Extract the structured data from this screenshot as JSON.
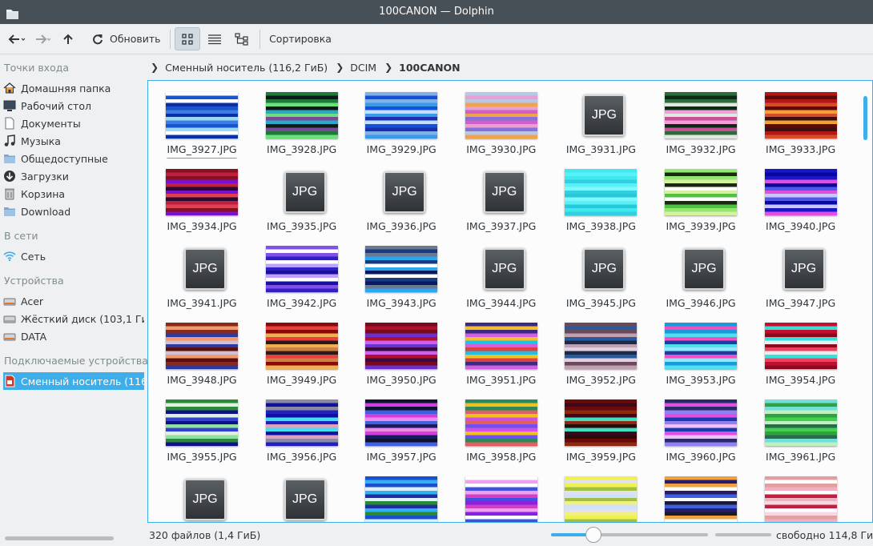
{
  "window": {
    "title": "100CANON — Dolphin"
  },
  "toolbar": {
    "reload_label": "Обновить",
    "sort_label": "Сортировка"
  },
  "sidebar": {
    "sections": [
      {
        "title": "Точки входа"
      },
      {
        "title": "В сети"
      },
      {
        "title": "Устройства"
      },
      {
        "title": "Подключаемые устройства"
      }
    ],
    "places": [
      {
        "label": "Домашняя папка",
        "icon": "home-icon"
      },
      {
        "label": "Рабочий стол",
        "icon": "desktop-icon"
      },
      {
        "label": "Документы",
        "icon": "document-icon"
      },
      {
        "label": "Музыка",
        "icon": "music-icon"
      },
      {
        "label": "Общедоступные",
        "icon": "folder-icon"
      },
      {
        "label": "Загрузки",
        "icon": "download-icon"
      },
      {
        "label": "Корзина",
        "icon": "trash-icon"
      },
      {
        "label": "Download",
        "icon": "folder-icon"
      }
    ],
    "network": [
      {
        "label": "Сеть",
        "icon": "wifi-icon"
      }
    ],
    "devices": [
      {
        "label": "Acer",
        "icon": "drive-icon"
      },
      {
        "label": "Жёсткий диск (103,1 ГиБ)",
        "icon": "drive-icon"
      },
      {
        "label": "DATA",
        "icon": "drive-icon"
      }
    ],
    "removable": [
      {
        "label": "Сменный носитель (116,2 ГиБ)",
        "icon": "sd-card-icon"
      }
    ]
  },
  "breadcrumb": [
    {
      "label": "Сменный носитель (116,2 ГиБ)"
    },
    {
      "label": "DCIM"
    },
    {
      "label": "100CANON"
    }
  ],
  "files": [
    {
      "name": "IMG_3927.JPG",
      "thumb": "glitch",
      "colors": [
        "#ffffff",
        "#1a55cc",
        "#0a2fa8",
        "#3b7ce8",
        "#9ad8f2"
      ]
    },
    {
      "name": "IMG_3928.JPG",
      "thumb": "glitch",
      "colors": [
        "#1e7a3a",
        "#0f1a16",
        "#6ce07a",
        "#2aa8c8",
        "#7a4a9a"
      ]
    },
    {
      "name": "IMG_3929.JPG",
      "thumb": "glitch",
      "colors": [
        "#7fb0e8",
        "#1750d8",
        "#3a9ae8",
        "#c0e0ff",
        "#1a2fb0"
      ]
    },
    {
      "name": "IMG_3930.JPG",
      "thumb": "glitch",
      "colors": [
        "#b8c6e8",
        "#e8a0d0",
        "#f4a24a",
        "#d060c8",
        "#8870d8"
      ]
    },
    {
      "name": "IMG_3931.JPG",
      "thumb": "jpg"
    },
    {
      "name": "IMG_3932.JPG",
      "thumb": "glitch",
      "colors": [
        "#2e6a3c",
        "#0e2a16",
        "#e0e8e0",
        "#f0a0d8",
        "#c85098"
      ]
    },
    {
      "name": "IMG_3933.JPG",
      "thumb": "glitch",
      "colors": [
        "#b01818",
        "#5c0a0a",
        "#d84a2a",
        "#f2a030",
        "#3a1010"
      ]
    },
    {
      "name": "IMG_3934.JPG",
      "thumb": "glitch",
      "colors": [
        "#8a1020",
        "#c02040",
        "#7a10d0",
        "#2a0a30",
        "#e04050"
      ]
    },
    {
      "name": "IMG_3935.JPG",
      "thumb": "jpg"
    },
    {
      "name": "IMG_3936.JPG",
      "thumb": "jpg"
    },
    {
      "name": "IMG_3937.JPG",
      "thumb": "jpg"
    },
    {
      "name": "IMG_3938.JPG",
      "thumb": "glitch",
      "colors": [
        "#40e8f0",
        "#5af0f8",
        "#30d0e0",
        "#80f8ff",
        "#28c8d8"
      ]
    },
    {
      "name": "IMG_3939.JPG",
      "thumb": "glitch",
      "colors": [
        "#90e870",
        "#1a2a10",
        "#d8f0a0",
        "#ffffff",
        "#50c040"
      ]
    },
    {
      "name": "IMG_3940.JPG",
      "thumb": "glitch",
      "colors": [
        "#1818c8",
        "#0808a0",
        "#e050e0",
        "#5058e8",
        "#c8c8f8"
      ]
    },
    {
      "name": "IMG_3941.JPG",
      "thumb": "jpg"
    },
    {
      "name": "IMG_3942.JPG",
      "thumb": "glitch",
      "colors": [
        "#8050e8",
        "#ffffff",
        "#3020c0",
        "#c0a0ff",
        "#1a10a0"
      ]
    },
    {
      "name": "IMG_3943.JPG",
      "thumb": "glitch",
      "colors": [
        "#6a7a90",
        "#1a3a80",
        "#28a8f0",
        "#ffffff",
        "#0a1a60"
      ]
    },
    {
      "name": "IMG_3944.JPG",
      "thumb": "jpg"
    },
    {
      "name": "IMG_3945.JPG",
      "thumb": "jpg"
    },
    {
      "name": "IMG_3946.JPG",
      "thumb": "jpg"
    },
    {
      "name": "IMG_3947.JPG",
      "thumb": "jpg"
    },
    {
      "name": "IMG_3948.JPG",
      "thumb": "glitch",
      "colors": [
        "#8a2a1a",
        "#f09a70",
        "#2a3aa0",
        "#d0c0d0",
        "#5a1010"
      ]
    },
    {
      "name": "IMG_3949.JPG",
      "thumb": "glitch",
      "colors": [
        "#8a0a0a",
        "#e84040",
        "#f0b050",
        "#2a1a1a",
        "#d08040"
      ]
    },
    {
      "name": "IMG_3950.JPG",
      "thumb": "glitch",
      "colors": [
        "#7a0a1a",
        "#b01030",
        "#6a30d0",
        "#d060e8",
        "#3a0a40"
      ]
    },
    {
      "name": "IMG_3951.JPG",
      "thumb": "glitch",
      "colors": [
        "#3a2a80",
        "#f0c030",
        "#d060e0",
        "#20c0e0",
        "#e04040"
      ]
    },
    {
      "name": "IMG_3952.JPG",
      "thumb": "glitch",
      "colors": [
        "#6a4a5a",
        "#2a5a9a",
        "#c0a0b0",
        "#1a2a4a",
        "#e0d0e0"
      ]
    },
    {
      "name": "IMG_3953.JPG",
      "thumb": "glitch",
      "colors": [
        "#1a9ad8",
        "#f050c0",
        "#50e0f0",
        "#203aa0",
        "#90e8f8"
      ]
    },
    {
      "name": "IMG_3954.JPG",
      "thumb": "glitch",
      "colors": [
        "#c01030",
        "#3ae0d8",
        "#8a0a20",
        "#e0f0f0",
        "#f04060"
      ]
    },
    {
      "name": "IMG_3955.JPG",
      "thumb": "glitch",
      "colors": [
        "#2a8a3a",
        "#e0f0e0",
        "#10108a",
        "#3040d0",
        "#90e0a0"
      ]
    },
    {
      "name": "IMG_3956.JPG",
      "thumb": "glitch",
      "colors": [
        "#8a8aa0",
        "#1010a0",
        "#2020c0",
        "#40e0f0",
        "#e0a0c0"
      ]
    },
    {
      "name": "IMG_3957.JPG",
      "thumb": "glitch",
      "colors": [
        "#101030",
        "#d040e0",
        "#4060e0",
        "#f08ae8",
        "#1a1a60"
      ]
    },
    {
      "name": "IMG_3958.JPG",
      "thumb": "glitch",
      "colors": [
        "#2a8a5a",
        "#f0c020",
        "#e06060",
        "#d050e0",
        "#7050f0"
      ]
    },
    {
      "name": "IMG_3959.JPG",
      "thumb": "glitch",
      "colors": [
        "#6a0a0a",
        "#3a0a1a",
        "#8a2a10",
        "#40e0c0",
        "#2a0a0a"
      ]
    },
    {
      "name": "IMG_3960.JPG",
      "thumb": "glitch",
      "colors": [
        "#2a2a6a",
        "#e050e0",
        "#9080f0",
        "#1a3ab0",
        "#f0c0f8"
      ]
    },
    {
      "name": "IMG_3961.JPG",
      "thumb": "glitch",
      "colors": [
        "#70e0d8",
        "#30a040",
        "#c0f0c0",
        "#40d050",
        "#2a6a4a"
      ]
    },
    {
      "name": "",
      "thumb": "jpg"
    },
    {
      "name": "",
      "thumb": "jpg"
    },
    {
      "name": "",
      "thumb": "glitch",
      "colors": [
        "#1a50d0",
        "#30b0f0",
        "#e0f0ff",
        "#1a30a0",
        "#2a8a30"
      ]
    },
    {
      "name": "",
      "thumb": "glitch",
      "colors": [
        "#ffffff",
        "#f0a0f0",
        "#4050e0",
        "#d040c0",
        "#8a20e0"
      ]
    },
    {
      "name": "",
      "thumb": "glitch",
      "colors": [
        "#f0f050",
        "#e0e0f0",
        "#a0c040",
        "#d0e0ff",
        "#f0f080"
      ]
    },
    {
      "name": "",
      "thumb": "glitch",
      "colors": [
        "#f0a040",
        "#2a1a6a",
        "#ffffff",
        "#4060e0",
        "#1a1a30"
      ]
    },
    {
      "name": "",
      "thumb": "glitch",
      "colors": [
        "#e0a0a0",
        "#ffffff",
        "#f0b0c0",
        "#c02040",
        "#f8d8e0"
      ]
    }
  ],
  "jpg_label": "JPG",
  "status": {
    "count_text": "320 файлов (1,4 ГиБ)",
    "zoom_fraction": 0.27,
    "free_space_text": "свободно 114,8 ГиБ"
  },
  "colors": {
    "accent": "#3daee9",
    "titlebar": "#475057",
    "window_bg": "#eff0f1",
    "view_bg": "#fcfcfc"
  }
}
